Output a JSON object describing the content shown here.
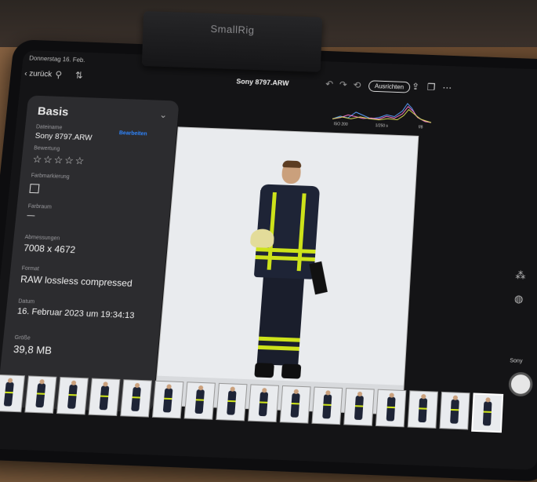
{
  "device": {
    "brand": "SmallRig"
  },
  "statusbar": {
    "date": "Donnerstag 16. Feb."
  },
  "topbar": {
    "back_label": "zurück",
    "filename": "Sony 8797.ARW",
    "edit_label": "Ausrichten"
  },
  "info_panel": {
    "title": "Basis",
    "filename_label": "Dateiname",
    "filename_value": "Sony 8797.ARW",
    "edit_link": "Bearbeiten",
    "rating_label": "Bewertung",
    "rating_value": "☆☆☆☆☆",
    "color_label": "Farbmarkierung",
    "colorspace_label": "Farbraum",
    "colorspace_value": "—",
    "dimensions_label": "Abmessungen",
    "dimensions_value": "7008 x 4672",
    "format_label": "Format",
    "format_value": "RAW lossless compressed",
    "date_label": "Datum",
    "date_value": "16. Februar 2023 um 19:34:13",
    "size_label": "Größe",
    "size_value": "39,8 MB"
  },
  "histogram": {
    "iso": "ISO 200",
    "shutter": "1/250 s",
    "aperture": "f/8"
  },
  "capture": {
    "label": "Sony"
  },
  "icons": {
    "back": "chevron-left-icon",
    "filter": "filter-icon",
    "sort": "sort-icon",
    "undo": "undo-icon",
    "redo": "redo-icon",
    "share": "share-icon",
    "more": "more-icon",
    "chevron": "chevron-down-icon"
  },
  "colors": {
    "accent": "#2f86ff",
    "reflective": "#cde21a",
    "jacket": "#1e2436"
  }
}
